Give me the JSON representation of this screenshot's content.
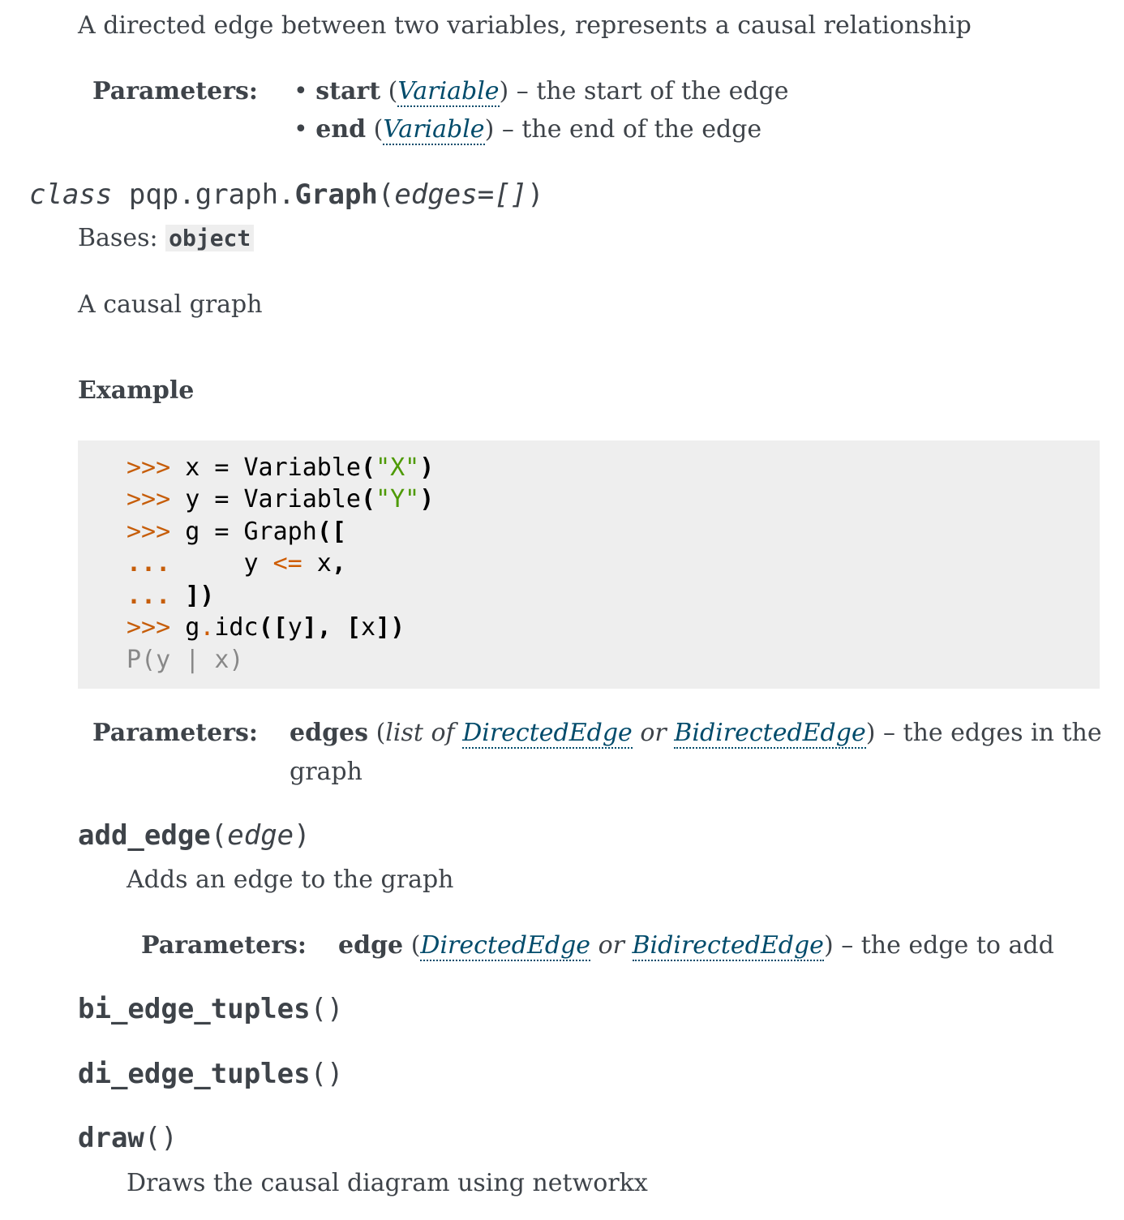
{
  "directed_edge": {
    "description": "A directed edge between two variables, represents a causal relationship",
    "params_label": "Parameters:",
    "params": [
      {
        "bullet": "•",
        "name": "start",
        "type": "Variable",
        "desc": " – the start of the edge"
      },
      {
        "bullet": "•",
        "name": "end",
        "type": "Variable",
        "desc": " – the end of the edge"
      }
    ]
  },
  "graph_class": {
    "keyword": "class",
    "module": "pqp.graph.",
    "name": "Graph",
    "open_paren": "(",
    "arg": "edges=[]",
    "close_paren": ")",
    "bases_label": "Bases: ",
    "bases_value": "object",
    "description": "A causal graph",
    "example_heading": "Example",
    "code_lines": [
      [
        {
          "t": ">>> ",
          "c": "prompt"
        },
        {
          "t": "x = Variable",
          "c": ""
        },
        {
          "t": "(",
          "c": "punc"
        },
        {
          "t": "\"X\"",
          "c": "str"
        },
        {
          "t": ")",
          "c": "punc"
        }
      ],
      [
        {
          "t": ">>> ",
          "c": "prompt"
        },
        {
          "t": "y = Variable",
          "c": ""
        },
        {
          "t": "(",
          "c": "punc"
        },
        {
          "t": "\"Y\"",
          "c": "str"
        },
        {
          "t": ")",
          "c": "punc"
        }
      ],
      [
        {
          "t": ">>> ",
          "c": "prompt"
        },
        {
          "t": "g = Graph",
          "c": ""
        },
        {
          "t": "([",
          "c": "punc"
        }
      ],
      [
        {
          "t": "...",
          "c": "cont"
        },
        {
          "t": "     y ",
          "c": ""
        },
        {
          "t": "<=",
          "c": "op"
        },
        {
          "t": " x",
          "c": ""
        },
        {
          "t": ",",
          "c": "punc"
        }
      ],
      [
        {
          "t": "...",
          "c": "cont"
        },
        {
          "t": " ",
          "c": ""
        },
        {
          "t": "])",
          "c": "punc"
        }
      ],
      [
        {
          "t": ">>> ",
          "c": "prompt"
        },
        {
          "t": "g",
          "c": ""
        },
        {
          "t": ".",
          "c": "op"
        },
        {
          "t": "idc",
          "c": ""
        },
        {
          "t": "([",
          "c": "punc"
        },
        {
          "t": "y",
          "c": ""
        },
        {
          "t": "],",
          "c": "punc"
        },
        {
          "t": " ",
          "c": ""
        },
        {
          "t": "[",
          "c": "punc"
        },
        {
          "t": "x",
          "c": ""
        },
        {
          "t": "])",
          "c": "punc"
        }
      ],
      [
        {
          "t": "P(y | x)",
          "c": "out"
        }
      ]
    ],
    "params_label": "Parameters:",
    "param_name": "edges",
    "param_type_prefix": "list of ",
    "param_type_link1": "DirectedEdge",
    "param_type_or": " or ",
    "param_type_link2": "BidirectedEdge",
    "param_desc_line1": " – the edges in the",
    "param_desc_line2": "graph"
  },
  "methods": {
    "add_edge": {
      "name": "add_edge",
      "open": "(",
      "arg": "edge",
      "close": ")",
      "description": "Adds an edge to the graph",
      "params_label": "Parameters:",
      "param_name": "edge",
      "type_link1": "DirectedEdge",
      "type_or": " or ",
      "type_link2": "BidirectedEdge",
      "param_desc": " – the edge to add"
    },
    "bi_edge_tuples": {
      "name": "bi_edge_tuples",
      "parens": "()"
    },
    "di_edge_tuples": {
      "name": "di_edge_tuples",
      "parens": "()"
    },
    "draw": {
      "name": "draw",
      "parens": "()",
      "description": "Draws the causal diagram using networkx"
    }
  }
}
